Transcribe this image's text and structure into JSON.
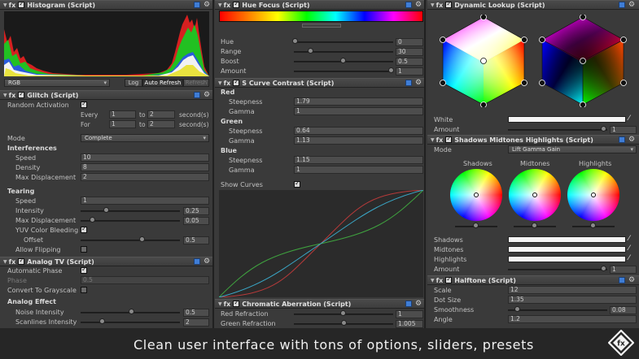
{
  "histogram": {
    "title": "Histogram (Script)",
    "channel": "RGB",
    "log_label": "Log",
    "auto_refresh_label": "Auto Refresh",
    "refresh_label": "Refresh"
  },
  "glitch": {
    "title": "Glitch (Script)",
    "random_activation_label": "Random Activation",
    "random_activation": true,
    "every_label": "Every",
    "every_from": "1",
    "every_to_label": "to",
    "every_to": "2",
    "every_unit": "second(s)",
    "for_label": "For",
    "for_from": "1",
    "for_to_label": "to",
    "for_to": "2",
    "for_unit": "second(s)",
    "mode_label": "Mode",
    "mode_value": "Complete",
    "interferences_label": "Interferences",
    "speed_label": "Speed",
    "speed_value": "10",
    "density_label": "Density",
    "density_value": "8",
    "max_disp_label": "Max Displacement",
    "max_disp_value": "2",
    "tearing_label": "Tearing",
    "t_speed_label": "Speed",
    "t_speed_value": "1",
    "intensity_label": "Intensity",
    "intensity_value": "0.25",
    "t_max_disp_label": "Max Displacement",
    "t_max_disp_value": "0.05",
    "yuv_label": "YUV Color Bleeding",
    "offset_label": "Offset",
    "offset_value": "0.5",
    "allow_flipping_label": "Allow Flipping"
  },
  "analog_tv": {
    "title": "Analog TV (Script)",
    "auto_phase_label": "Automatic Phase",
    "phase_label": "Phase",
    "phase_value": "0.5",
    "grayscale_label": "Convert To Grayscale",
    "analog_effect_label": "Analog Effect",
    "noise_label": "Noise Intensity",
    "noise_value": "0.5",
    "scanlines_label": "Scanlines Intensity",
    "scanlines_value": "2"
  },
  "hue_focus": {
    "title": "Hue Focus (Script)",
    "hue_label": "Hue",
    "hue_value": "0",
    "range_label": "Range",
    "range_value": "30",
    "boost_label": "Boost",
    "boost_value": "0.5",
    "amount_label": "Amount",
    "amount_value": "1"
  },
  "s_curve": {
    "title": "S Curve Contrast (Script)",
    "red_label": "Red",
    "red_steepness_label": "Steepness",
    "red_steepness": "1.79",
    "red_gamma_label": "Gamma",
    "red_gamma": "1",
    "green_label": "Green",
    "green_steepness_label": "Steepness",
    "green_steepness": "0.64",
    "green_gamma_label": "Gamma",
    "green_gamma": "1.13",
    "blue_label": "Blue",
    "blue_steepness_label": "Steepness",
    "blue_steepness": "1.15",
    "blue_gamma_label": "Gamma",
    "blue_gamma": "1",
    "show_curves_label": "Show Curves"
  },
  "chromatic": {
    "title": "Chromatic Aberration (Script)",
    "red_label": "Red Refraction",
    "red_value": "1",
    "green_label": "Green Refraction",
    "green_value": "1.005"
  },
  "dynamic_lookup": {
    "title": "Dynamic Lookup (Script)",
    "white_label": "White",
    "amount_label": "Amount",
    "amount_value": "1"
  },
  "smh": {
    "title": "Shadows Midtones Highlights (Script)",
    "mode_label": "Mode",
    "mode_value": "Lift Gamma Gain",
    "shadows_title": "Shadows",
    "midtones_title": "Midtones",
    "highlights_title": "Highlights",
    "shadows_label": "Shadows",
    "midtones_label": "Midtones",
    "highlights_label": "Highlights",
    "amount_label": "Amount",
    "amount_value": "1"
  },
  "halftone": {
    "title": "Halftone (Script)",
    "scale_label": "Scale",
    "scale_value": "12",
    "dot_size_label": "Dot Size",
    "dot_size_value": "1.35",
    "smoothness_label": "Smoothness",
    "smoothness_value": "0.08",
    "angle_label": "Angle",
    "angle_value": "1.2"
  },
  "banner": {
    "text": "Clean user interface with tons of options, sliders, presets",
    "logo_text": "fx"
  },
  "fx_label": "fx",
  "colors": {
    "panel_bg": "#3a3a3a",
    "banner_bg": "#262626",
    "curve_red": "#b83a3a",
    "curve_green": "#3fa33f",
    "curve_blue": "#3aa8c8"
  }
}
